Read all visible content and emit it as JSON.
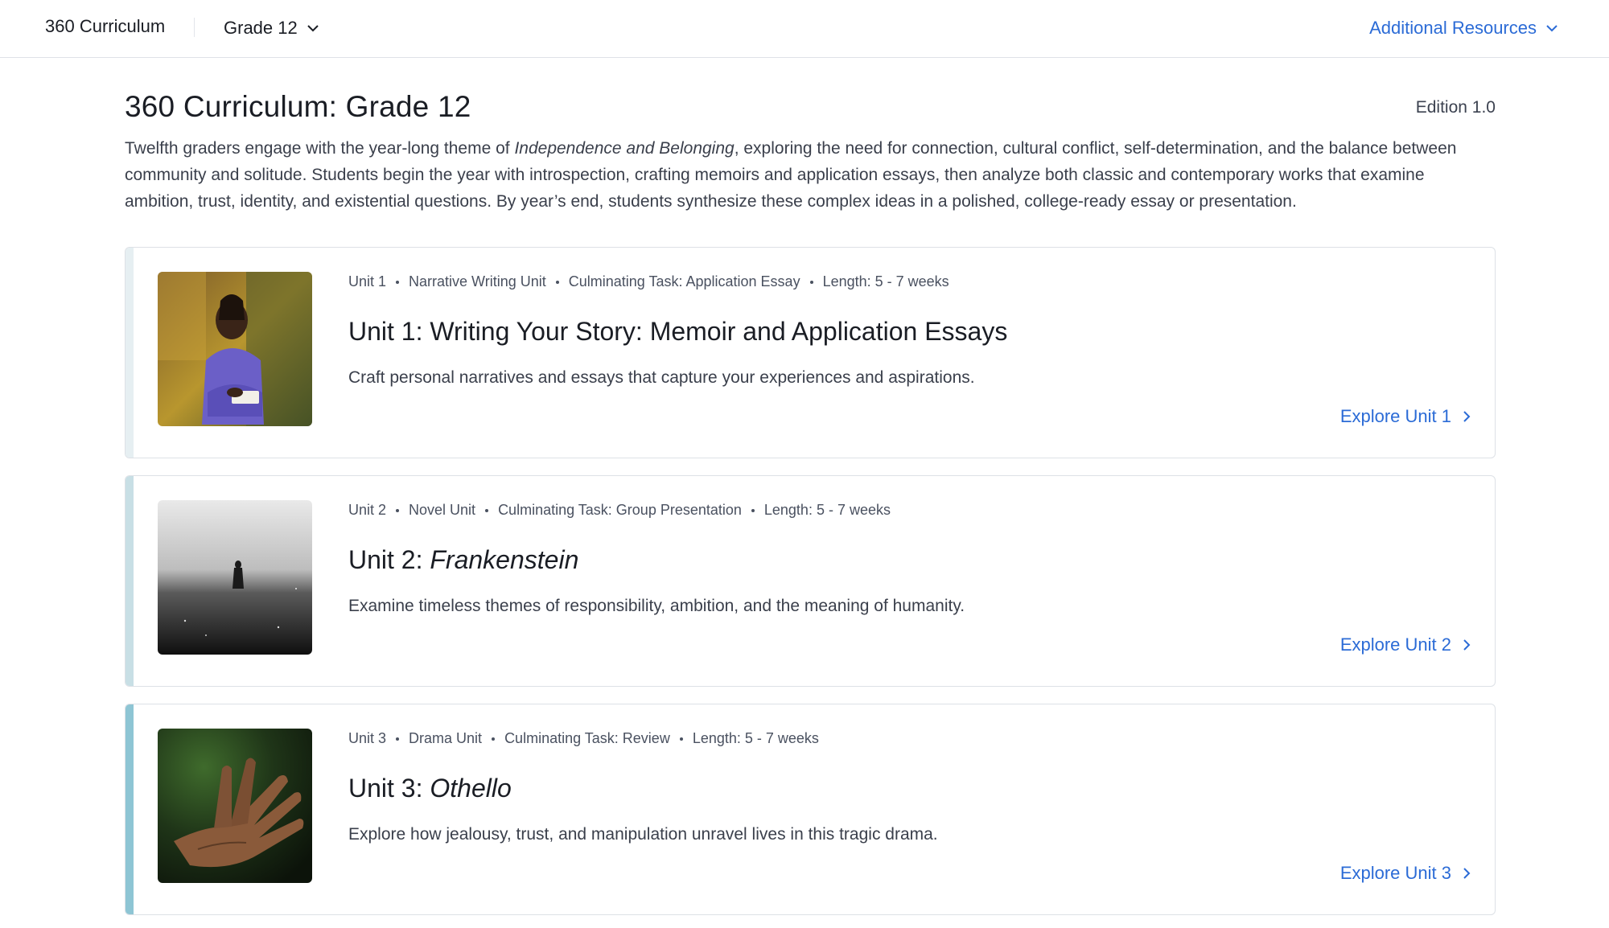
{
  "nav": {
    "brand": "360 Curriculum",
    "grade_select": "Grade 12",
    "resources_label": "Additional Resources"
  },
  "header": {
    "title": "360 Curriculum: Grade 12",
    "edition": "Edition 1.0",
    "intro_before": "Twelfth graders engage with the year-long theme of ",
    "intro_theme": "Independence and Belonging",
    "intro_after": ", exploring the need for connection, cultural conflict, self-determination, and the balance between community and solitude. Students begin the year with introspection, crafting memoirs and application essays, then analyze both classic and contemporary works that examine ambition, trust, identity, and existential questions. By year’s end, students synthesize these complex ideas in a polished, college-ready essay or presentation."
  },
  "units": [
    {
      "meta": [
        "Unit 1",
        "Narrative Writing Unit",
        "Culminating Task: Application Essay",
        "Length: 5 - 7 weeks"
      ],
      "title_prefix": "Unit 1: Writing Your Story: Memoir and Application Essays",
      "title_italic": "",
      "description": "Craft personal narratives and essays that capture your experiences and aspirations.",
      "explore_label": "Explore Unit 1",
      "accent_color": "#e6eff2",
      "image": "photo-student-writing"
    },
    {
      "meta": [
        "Unit 2",
        "Novel Unit",
        "Culminating Task: Group Presentation",
        "Length: 5 - 7 weeks"
      ],
      "title_prefix": "Unit 2: ",
      "title_italic": "Frankenstein",
      "description": "Examine timeless themes of responsibility, ambition, and the meaning of humanity.",
      "explore_label": "Explore Unit 2",
      "accent_color": "#c8dfe5",
      "image": "photo-figure-in-fog"
    },
    {
      "meta": [
        "Unit 3",
        "Drama Unit",
        "Culminating Task: Review",
        "Length: 5 - 7 weeks"
      ],
      "title_prefix": "Unit 3: ",
      "title_italic": "Othello",
      "description": "Explore how jealousy, trust, and manipulation unravel lives in this tragic drama.",
      "explore_label": "Explore Unit 3",
      "accent_color": "#8ec5d4",
      "image": "photo-open-hand"
    }
  ],
  "colors": {
    "link": "#2b6bd6",
    "text": "#1a1d24",
    "border": "#dde1e6"
  }
}
